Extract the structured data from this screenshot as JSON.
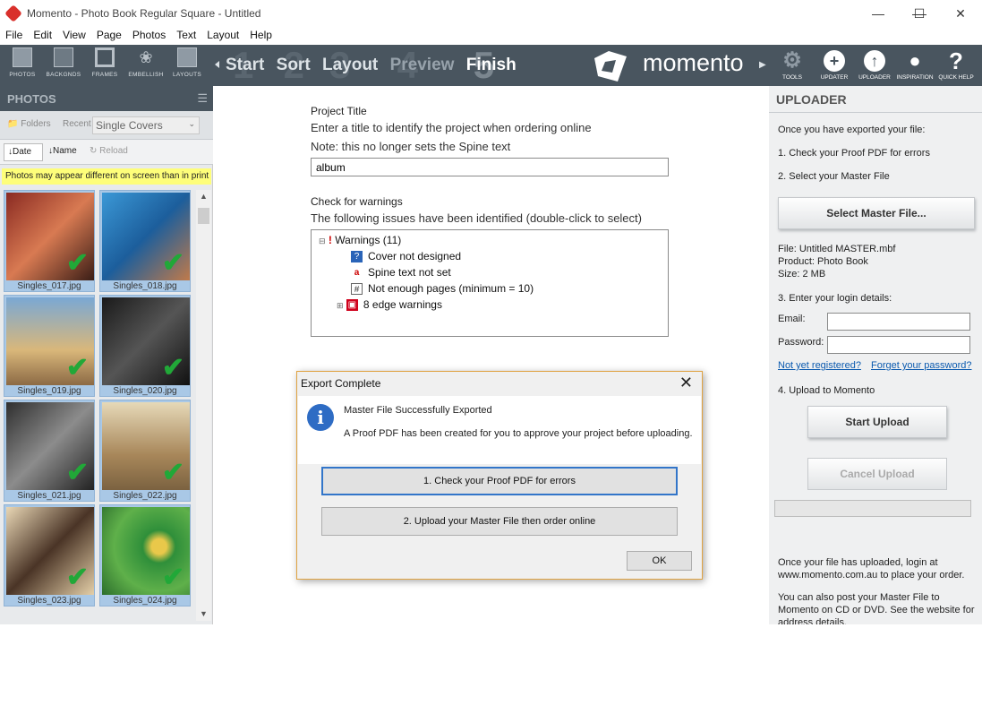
{
  "window": {
    "title": "Momento - Photo Book Regular Square - Untitled"
  },
  "menu": [
    "File",
    "Edit",
    "View",
    "Page",
    "Photos",
    "Text",
    "Layout",
    "Help"
  ],
  "toolbar": {
    "tools": [
      "PHOTOS",
      "BACKGNDS",
      "FRAMES",
      "EMBELLISH",
      "LAYOUTS"
    ],
    "steps": [
      {
        "num": "1",
        "label": "Start"
      },
      {
        "num": "2",
        "label": "Sort"
      },
      {
        "num": "3",
        "label": "Layout"
      },
      {
        "num": "4",
        "label": "Preview"
      },
      {
        "num": "5",
        "label": "Finish"
      }
    ],
    "brand": "momento",
    "right_tools": [
      "TOOLS",
      "UPDATER",
      "UPDATER",
      "INSPIRATION",
      "QUICK HELP"
    ]
  },
  "photos_panel": {
    "title": "PHOTOS",
    "folders_label": "Folders",
    "recent_label": "Recent",
    "source_value": "Single Covers",
    "sort_date": "Date",
    "sort_name": "Name",
    "reload": "Reload",
    "warning": "Photos may appear different on screen than in print",
    "thumbs": [
      "Singles_017.jpg",
      "Singles_018.jpg",
      "Singles_019.jpg",
      "Singles_020.jpg",
      "Singles_021.jpg",
      "Singles_022.jpg",
      "Singles_023.jpg",
      "Singles_024.jpg"
    ]
  },
  "center": {
    "project_title_label": "Project Title",
    "project_title_hint": "Enter a title to identify the project when ordering online",
    "project_title_note": "Note: this no longer sets the Spine text",
    "project_title_value": "album",
    "warnings_label": "Check for warnings",
    "warnings_hint": "The following issues have been identified (double-click to select)",
    "tree": {
      "root": "Warnings (11)",
      "items": [
        "Cover not designed",
        "Spine text not set",
        "Not enough pages (minimum = 10)",
        "8 edge warnings"
      ]
    }
  },
  "uploader": {
    "title": "UPLOADER",
    "intro": "Once you have exported your file:",
    "step1": "1. Check your Proof PDF for errors",
    "step2": "2. Select your Master File",
    "select_button": "Select Master File...",
    "file_line": "File: Untitled MASTER.mbf",
    "product_line": "Product: Photo Book",
    "size_line": "Size: 2 MB",
    "step3": "3. Enter your login details:",
    "email_label": "Email:",
    "password_label": "Password:",
    "not_registered": "Not yet registered?",
    "forgot": "Forget your password?",
    "step4": "4. Upload to Momento",
    "start_upload": "Start Upload",
    "cancel_upload": "Cancel Upload",
    "footer1": "Once your file has uploaded, login at www.momento.com.au to place your order.",
    "footer2": "You can also post your Master File to Momento on CD or DVD. See the website for address details."
  },
  "dialog": {
    "title": "Export Complete",
    "heading": "Master File Successfully Exported",
    "message": "A Proof PDF has been created for you to approve your project before uploading.",
    "btn1": "1. Check your Proof PDF for errors",
    "btn2": "2. Upload your Master File then order online",
    "ok": "OK"
  },
  "colors": {
    "toolbar": "#49555f",
    "warning_bar": "#fefe7a",
    "check": "#21a838",
    "dialog_border": "#e0a342"
  }
}
